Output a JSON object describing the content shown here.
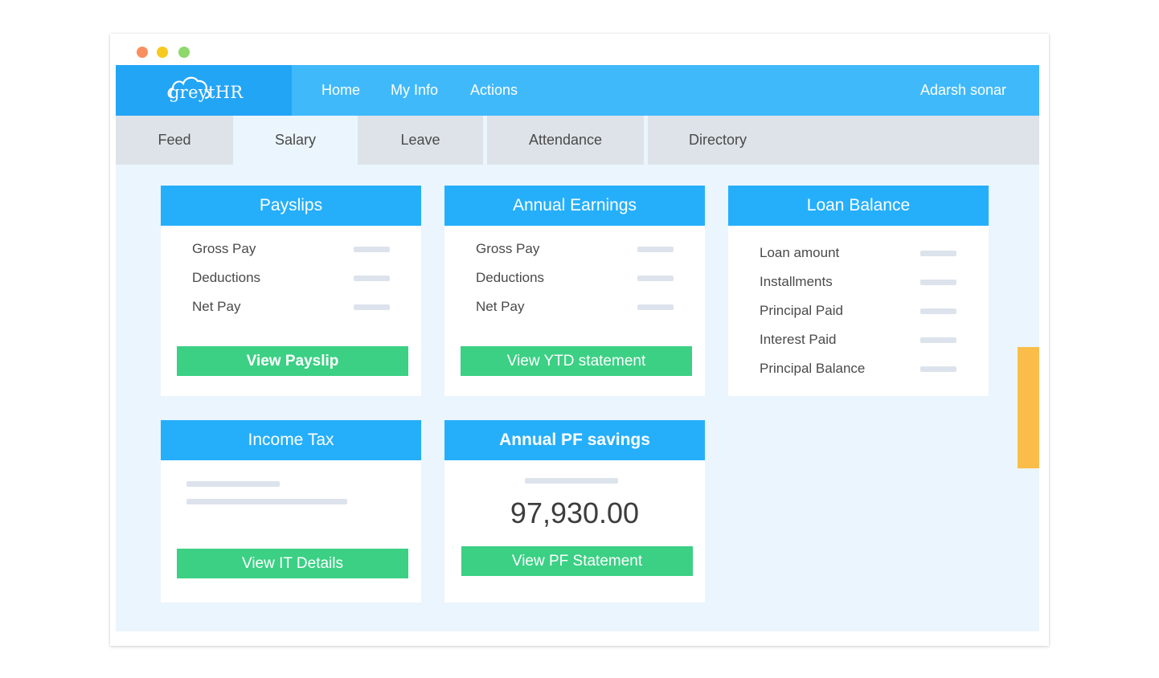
{
  "window": {
    "controls": [
      "close",
      "minimize",
      "maximize"
    ]
  },
  "brand": {
    "logo_text": "greytHR",
    "icon": "cloud-icon"
  },
  "nav": {
    "home": "Home",
    "my_info": "My Info",
    "actions": "Actions"
  },
  "user": {
    "name": "Adarsh sonar"
  },
  "tabs": [
    "Feed",
    "Salary",
    "Leave",
    "Attendance",
    "Directory"
  ],
  "active_tab": "Salary",
  "cards": {
    "payslips": {
      "title": "Payslips",
      "rows": [
        "Gross Pay",
        "Deductions",
        "Net Pay"
      ],
      "button": "View Payslip"
    },
    "annual_earnings": {
      "title": "Annual Earnings",
      "rows": [
        "Gross Pay",
        "Deductions",
        "Net Pay"
      ],
      "button": "View YTD statement"
    },
    "loan_balance": {
      "title": "Loan Balance",
      "rows": [
        "Loan amount",
        "Installments",
        "Principal Paid",
        "Interest Paid",
        "Principal Balance"
      ]
    },
    "income_tax": {
      "title": "Income Tax",
      "button": "View IT Details"
    },
    "annual_pf": {
      "title": "Annual PF savings",
      "value": "97,930.00",
      "button": "View PF Statement"
    }
  },
  "colors": {
    "topbar": "#40b9fb",
    "logo_bg": "#23a5f6",
    "card_header": "#25affb",
    "button": "#3bd084",
    "side_handle": "#fbbd4a"
  }
}
